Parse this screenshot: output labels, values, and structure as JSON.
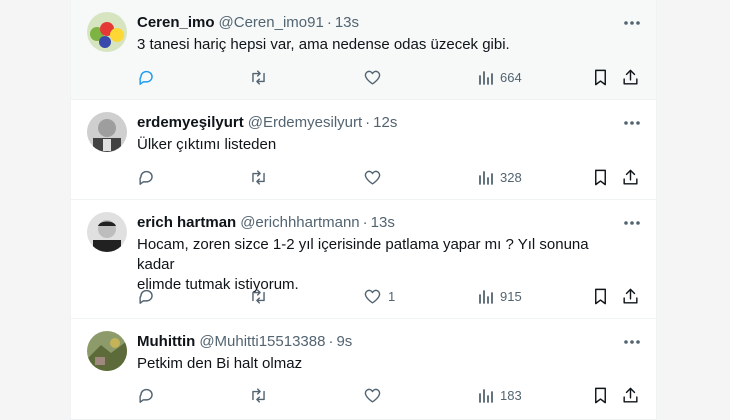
{
  "tweets": [
    {
      "name": "Ceren_imo",
      "handle": "@Ceren_imo91",
      "dot": "·",
      "time": "13s",
      "text": "3 tanesi hariç hepsi var, ama nedense odas üzecek gibi.",
      "replies": "",
      "retweets": "",
      "likes": "",
      "views": "664",
      "avatar_colors": [
        "#7cb342",
        "#e53935",
        "#fdd835",
        "#3949ab"
      ]
    },
    {
      "name": "erdemyeşilyurt",
      "handle": "@Erdemyesilyurt",
      "dot": "·",
      "time": "12s",
      "text": "Ülker çıktımı listeden",
      "replies": "",
      "retweets": "",
      "likes": "",
      "views": "328",
      "avatar_colors": [
        "#9e9e9e",
        "#424242",
        "#e0e0e0",
        "#616161"
      ]
    },
    {
      "name": "erich hartman",
      "handle": "@erichhhartmann",
      "dot": "·",
      "time": "13s",
      "text_lines": [
        "Hocam, zoren sizce 1-2 yıl içerisinde patlama yapar mı ? Yıl sonuna kadar",
        "elimde tutmak istiyorum."
      ],
      "replies": "",
      "retweets": "",
      "likes": "1",
      "views": "915",
      "avatar_colors": [
        "#bdbdbd",
        "#212121",
        "#757575",
        "#e0e0e0"
      ]
    },
    {
      "name": "Muhittin",
      "handle": "@Muhitti15513388",
      "dot": "·",
      "time": "9s",
      "text": "Petkim den Bi halt olmaz",
      "replies": "",
      "retweets": "",
      "likes": "",
      "views": "183",
      "avatar_colors": [
        "#8d9b6a",
        "#c5b358",
        "#5d6b3a",
        "#a1887f"
      ]
    }
  ],
  "colors": {
    "text": "#0f1419",
    "muted": "#536471",
    "accent": "#1d9bf0",
    "border": "#eff3f4"
  },
  "icons": {
    "reply": "reply-icon",
    "retweet": "retweet-icon",
    "like": "heart-icon",
    "views": "views-chart-icon",
    "bookmark": "bookmark-icon",
    "share": "share-icon",
    "more": "more-dots-icon"
  }
}
